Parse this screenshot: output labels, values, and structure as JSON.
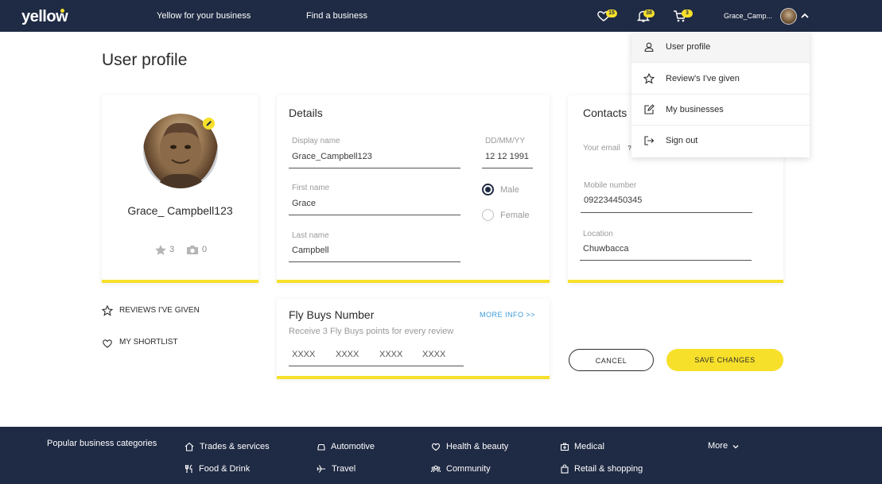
{
  "header": {
    "logo": "yellow",
    "nav": [
      "Yellow for your business",
      "Find a business"
    ],
    "favorites_count": "15",
    "notifications_count": "38",
    "cart_count": "3",
    "user_name": "Grace_Camp..."
  },
  "page_title": "User profile",
  "profile": {
    "name": "Grace_ Campbell123",
    "review_count": "3",
    "photo_count": "0"
  },
  "side_links": {
    "reviews": "REVIEWS I'VE GIVEN",
    "shortlist": "MY SHORTLIST"
  },
  "details": {
    "title": "Details",
    "display_name_label": "Display name",
    "display_name": "Grace_Campbell123",
    "dob_label": "DD/MM/YY",
    "dob": "12 12 1991",
    "first_name_label": "First name",
    "first_name": "Grace",
    "last_name_label": "Last name",
    "last_name": "Campbell",
    "gender_male": "Male",
    "gender_female": "Female",
    "gender_selected": "Male"
  },
  "contacts": {
    "title": "Contacts",
    "email_label": "Your email",
    "help_mark": "?",
    "mobile_label": "Mobile number",
    "mobile": "092234450345",
    "location_label": "Location",
    "location": "Chuwbacca"
  },
  "flybuys": {
    "title": "Fly Buys Number",
    "more_info": "MORE INFO >>",
    "subtitle": "Receive 3 Fly Buys points for every review",
    "placeholders": [
      "XXXX",
      "XXXX",
      "XXXX",
      "XXXX"
    ]
  },
  "buttons": {
    "cancel": "CANCEL",
    "save": "SAVE CHANGES"
  },
  "dropdown": {
    "items": [
      "User profile",
      "Review's I've given",
      "My businesses",
      "Sign out"
    ]
  },
  "footer": {
    "title": "Popular business categories",
    "categories": [
      "Trades & services",
      "Automotive",
      "Health & beauty",
      "Medical",
      "Food & Drink",
      "Travel",
      "Community",
      "Retail & shopping"
    ],
    "more": "More"
  },
  "colors": {
    "navy": "#1f2a44",
    "yellow": "#f7e02a",
    "link_blue": "#3b9bd8"
  }
}
